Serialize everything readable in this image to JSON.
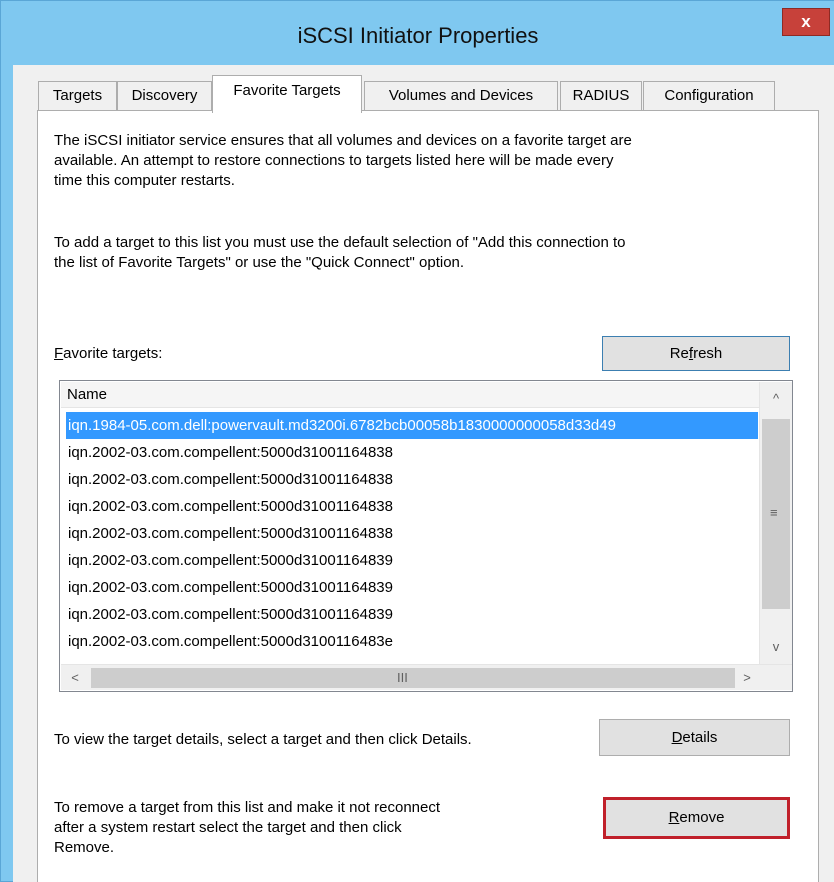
{
  "window": {
    "title": "iSCSI Initiator Properties",
    "close_glyph": "x"
  },
  "tabs": [
    {
      "label": "Targets"
    },
    {
      "label": "Discovery"
    },
    {
      "label": "Favorite Targets",
      "active": true
    },
    {
      "label": "Volumes and Devices"
    },
    {
      "label": "RADIUS"
    },
    {
      "label": "Configuration"
    }
  ],
  "intro": {
    "line1": "The iSCSI initiator service ensures that all volumes and devices on a favorite target are",
    "line2": "available.  An attempt to restore connections to targets listed here will be made every",
    "line3": "time this computer restarts."
  },
  "add_info": {
    "line1": "To add a target to this list you must use the default selection of \"Add this connection to",
    "line2": "the list of Favorite Targets\" or use the \"Quick Connect\" option."
  },
  "favorites": {
    "label_mnemonic": "F",
    "label_rest": "avorite targets:",
    "refresh_pre": "Re",
    "refresh_mnemonic": "f",
    "refresh_post": "resh",
    "column_name": "Name",
    "rows": [
      "iqn.1984-05.com.dell:powervault.md3200i.6782bcb00058b1830000000058d33d49",
      "iqn.2002-03.com.compellent:5000d31001164838",
      "iqn.2002-03.com.compellent:5000d31001164838",
      "iqn.2002-03.com.compellent:5000d31001164838",
      "iqn.2002-03.com.compellent:5000d31001164838",
      "iqn.2002-03.com.compellent:5000d31001164839",
      "iqn.2002-03.com.compellent:5000d31001164839",
      "iqn.2002-03.com.compellent:5000d31001164839",
      "iqn.2002-03.com.compellent:5000d3100116483e"
    ],
    "selected_index": 0,
    "scroll_up": "^",
    "scroll_down": "v",
    "scroll_left": "<",
    "scroll_right": ">",
    "vgrip": "≡",
    "hgrip": "III"
  },
  "details": {
    "text": "To view the target details, select a target and then click Details.",
    "button_mnemonic": "D",
    "button_rest": "etails"
  },
  "remove": {
    "line1": "To remove a target from this list and make it not reconnect",
    "line2": "after a system restart select the target and then click",
    "line3": "Remove.",
    "button_mnemonic": "R",
    "button_rest": "emove",
    "highlight_color": "#c0202a"
  },
  "colors": {
    "title_bar": "#7fc8f0",
    "close_button": "#c7413a",
    "selection": "#3399ff"
  }
}
